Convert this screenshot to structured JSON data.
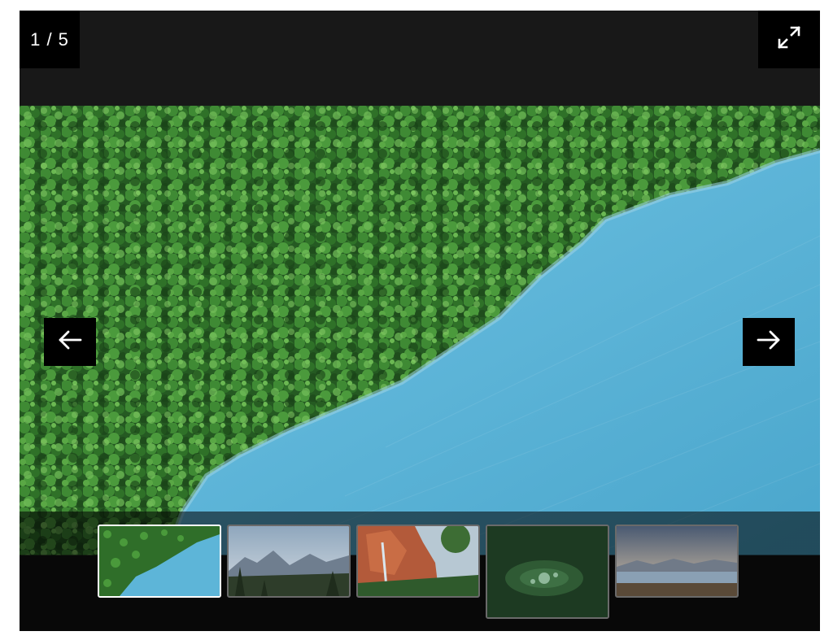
{
  "gallery": {
    "counter": "1 / 5",
    "current_index": 1,
    "total": 5,
    "fullscreen_icon": "expand-arrows-icon",
    "prev_icon": "arrow-left-icon",
    "next_icon": "arrow-right-icon",
    "colors": {
      "panel_bg": "#181818",
      "button_bg": "#000000",
      "icon": "#ffffff",
      "forest": "#2f6b2a",
      "water": "#5bb4d8"
    },
    "thumbnails": [
      {
        "scene": "forest-lake-aerial",
        "active": true
      },
      {
        "scene": "mountain-valley-forest",
        "active": false
      },
      {
        "scene": "red-rock-waterfall",
        "active": false
      },
      {
        "scene": "water-droplet-leaf",
        "active": false
      },
      {
        "scene": "lake-snowy-mountains",
        "active": false
      }
    ]
  }
}
